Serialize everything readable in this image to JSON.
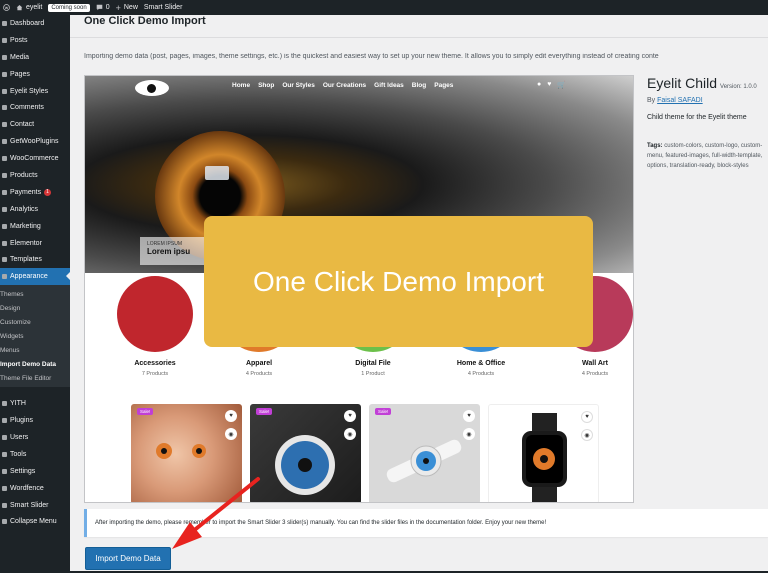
{
  "admin_bar": {
    "site_name": "eyelit",
    "coming_soon": "Coming soon",
    "comments_count": "0",
    "new_label": "New",
    "smart_slider": "Smart Slider"
  },
  "sidebar": {
    "items_top": [
      {
        "label": "Dashboard"
      },
      {
        "label": "Posts"
      },
      {
        "label": "Media"
      },
      {
        "label": "Pages"
      },
      {
        "label": "Eyelit Styles"
      },
      {
        "label": "Comments"
      },
      {
        "label": "Contact"
      },
      {
        "label": "GetWooPlugins"
      },
      {
        "label": "WooCommerce"
      },
      {
        "label": "Products"
      },
      {
        "label": "Payments",
        "badge": "1"
      },
      {
        "label": "Analytics"
      },
      {
        "label": "Marketing"
      },
      {
        "label": "Elementor"
      },
      {
        "label": "Templates"
      },
      {
        "label": "Appearance"
      }
    ],
    "submenu": [
      {
        "label": "Themes"
      },
      {
        "label": "Design"
      },
      {
        "label": "Customize"
      },
      {
        "label": "Widgets"
      },
      {
        "label": "Menus"
      },
      {
        "label": "Import Demo Data"
      },
      {
        "label": "Theme File Editor"
      }
    ],
    "items_bottom": [
      {
        "label": "YITH"
      },
      {
        "label": "Plugins"
      },
      {
        "label": "Users"
      },
      {
        "label": "Tools"
      },
      {
        "label": "Settings"
      },
      {
        "label": "Wordfence"
      },
      {
        "label": "Smart Slider"
      },
      {
        "label": "Collapse Menu"
      }
    ]
  },
  "main": {
    "title": "One Click Demo Import",
    "intro": "Importing demo data (post, pages, images, theme settings, etc.) is the quickest and easiest way to set up your new theme. It allows you to simply edit everything instead of creating conte",
    "preview": {
      "nav_links": [
        "Home",
        "Shop",
        "Our Styles",
        "Our Creations",
        "Gift Ideas",
        "Blog",
        "Pages"
      ],
      "caption_small": "LOREM IPSUM",
      "caption_big": "Lorem ipsu",
      "categories": [
        {
          "name": "Accessories",
          "count": "7 Products",
          "color": "#c0262d"
        },
        {
          "name": "Apparel",
          "count": "4 Products",
          "color": "#e07a2a"
        },
        {
          "name": "Digital File",
          "count": "1 Product",
          "color": "#6cc04a"
        },
        {
          "name": "Home & Office",
          "count": "4 Products",
          "color": "#3a8fd6"
        },
        {
          "name": "Wall Art",
          "count": "4 Products",
          "color": "#b83a5a"
        }
      ],
      "sale_label": "Sale!"
    },
    "theme": {
      "name": "Eyelit Child",
      "version": "Version: 1.0.0",
      "author_prefix": "By",
      "author": "Faisal SAFADI",
      "description": "Child theme for the Eyelit theme",
      "tags_label": "Tags:",
      "tags": "custom-colors, custom-logo, custom-menu, featured-images, full-width-template, options, translation-ready, block-styles"
    },
    "notice": "After importing the demo, please remember to import the Smart Slider 3 slider(s) manually. You can find the slider files in the documentation folder. Enjoy your new theme!",
    "import_button": "Import Demo Data"
  },
  "overlay": {
    "text": "One Click Demo Import",
    "color": "#e9b943"
  },
  "colors": {
    "wp_dark": "#1d2327",
    "wp_blue": "#2271b1",
    "arrow": "#e8231f"
  }
}
